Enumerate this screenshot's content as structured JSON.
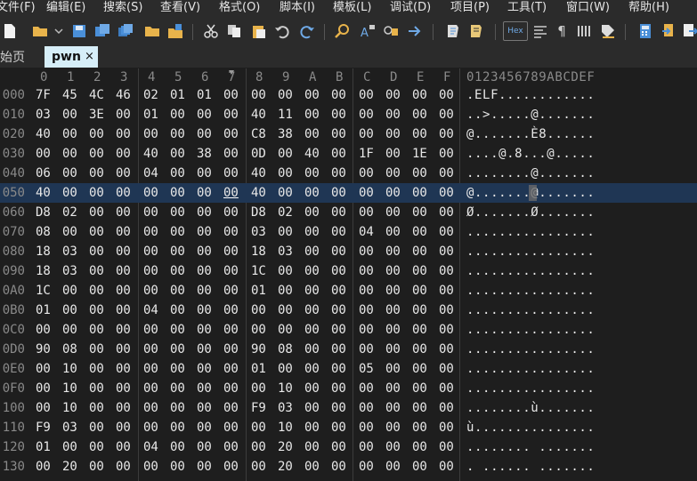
{
  "menus": [
    "文件(F)",
    "编辑(E)",
    "搜索(S)",
    "查看(V)",
    "格式(O)",
    "脚本(I)",
    "模板(L)",
    "调试(D)",
    "项目(P)",
    "工具(T)",
    "窗口(W)",
    "帮助(H)"
  ],
  "tabs": [
    {
      "label": "始页"
    },
    {
      "label": "pwn",
      "close": "×"
    }
  ],
  "toolbar": {
    "hex_label": "Hex"
  },
  "hex_header": [
    "0",
    "1",
    "2",
    "3",
    "4",
    "5",
    "6",
    "7",
    "8",
    "9",
    "A",
    "B",
    "C",
    "D",
    "E",
    "F"
  ],
  "ascii_header": "0123456789ABCDEF",
  "rows": [
    {
      "offset": "000",
      "bytes": [
        "7F",
        "45",
        "4C",
        "46",
        "02",
        "01",
        "01",
        "00",
        "00",
        "00",
        "00",
        "00",
        "00",
        "00",
        "00",
        "00"
      ],
      "ascii": ".ELF............"
    },
    {
      "offset": "010",
      "bytes": [
        "03",
        "00",
        "3E",
        "00",
        "01",
        "00",
        "00",
        "00",
        "40",
        "11",
        "00",
        "00",
        "00",
        "00",
        "00",
        "00"
      ],
      "ascii": "..>.....@......."
    },
    {
      "offset": "020",
      "bytes": [
        "40",
        "00",
        "00",
        "00",
        "00",
        "00",
        "00",
        "00",
        "C8",
        "38",
        "00",
        "00",
        "00",
        "00",
        "00",
        "00"
      ],
      "ascii": "@.......È8......"
    },
    {
      "offset": "030",
      "bytes": [
        "00",
        "00",
        "00",
        "00",
        "40",
        "00",
        "38",
        "00",
        "0D",
        "00",
        "40",
        "00",
        "1F",
        "00",
        "1E",
        "00"
      ],
      "ascii": "....@.8...@....."
    },
    {
      "offset": "040",
      "bytes": [
        "06",
        "00",
        "00",
        "00",
        "04",
        "00",
        "00",
        "00",
        "40",
        "00",
        "00",
        "00",
        "00",
        "00",
        "00",
        "00"
      ],
      "ascii": "........@......."
    },
    {
      "offset": "050",
      "bytes": [
        "40",
        "00",
        "00",
        "00",
        "00",
        "00",
        "00",
        "00",
        "40",
        "00",
        "00",
        "00",
        "00",
        "00",
        "00",
        "00"
      ],
      "ascii": "@.......@.......",
      "highlight": true
    },
    {
      "offset": "060",
      "bytes": [
        "D8",
        "02",
        "00",
        "00",
        "00",
        "00",
        "00",
        "00",
        "D8",
        "02",
        "00",
        "00",
        "00",
        "00",
        "00",
        "00"
      ],
      "ascii": "Ø.......Ø......."
    },
    {
      "offset": "070",
      "bytes": [
        "08",
        "00",
        "00",
        "00",
        "00",
        "00",
        "00",
        "00",
        "03",
        "00",
        "00",
        "00",
        "04",
        "00",
        "00",
        "00"
      ],
      "ascii": "................"
    },
    {
      "offset": "080",
      "bytes": [
        "18",
        "03",
        "00",
        "00",
        "00",
        "00",
        "00",
        "00",
        "18",
        "03",
        "00",
        "00",
        "00",
        "00",
        "00",
        "00"
      ],
      "ascii": "................"
    },
    {
      "offset": "090",
      "bytes": [
        "18",
        "03",
        "00",
        "00",
        "00",
        "00",
        "00",
        "00",
        "1C",
        "00",
        "00",
        "00",
        "00",
        "00",
        "00",
        "00"
      ],
      "ascii": "................"
    },
    {
      "offset": "0A0",
      "bytes": [
        "1C",
        "00",
        "00",
        "00",
        "00",
        "00",
        "00",
        "00",
        "01",
        "00",
        "00",
        "00",
        "00",
        "00",
        "00",
        "00"
      ],
      "ascii": "................"
    },
    {
      "offset": "0B0",
      "bytes": [
        "01",
        "00",
        "00",
        "00",
        "04",
        "00",
        "00",
        "00",
        "00",
        "00",
        "00",
        "00",
        "00",
        "00",
        "00",
        "00"
      ],
      "ascii": "................"
    },
    {
      "offset": "0C0",
      "bytes": [
        "00",
        "00",
        "00",
        "00",
        "00",
        "00",
        "00",
        "00",
        "00",
        "00",
        "00",
        "00",
        "00",
        "00",
        "00",
        "00"
      ],
      "ascii": "................"
    },
    {
      "offset": "0D0",
      "bytes": [
        "90",
        "08",
        "00",
        "00",
        "00",
        "00",
        "00",
        "00",
        "90",
        "08",
        "00",
        "00",
        "00",
        "00",
        "00",
        "00"
      ],
      "ascii": "................"
    },
    {
      "offset": "0E0",
      "bytes": [
        "00",
        "10",
        "00",
        "00",
        "00",
        "00",
        "00",
        "00",
        "01",
        "00",
        "00",
        "00",
        "05",
        "00",
        "00",
        "00"
      ],
      "ascii": "................"
    },
    {
      "offset": "0F0",
      "bytes": [
        "00",
        "10",
        "00",
        "00",
        "00",
        "00",
        "00",
        "00",
        "00",
        "10",
        "00",
        "00",
        "00",
        "00",
        "00",
        "00"
      ],
      "ascii": "................"
    },
    {
      "offset": "100",
      "bytes": [
        "00",
        "10",
        "00",
        "00",
        "00",
        "00",
        "00",
        "00",
        "F9",
        "03",
        "00",
        "00",
        "00",
        "00",
        "00",
        "00"
      ],
      "ascii": "........ù......."
    },
    {
      "offset": "110",
      "bytes": [
        "F9",
        "03",
        "00",
        "00",
        "00",
        "00",
        "00",
        "00",
        "00",
        "10",
        "00",
        "00",
        "00",
        "00",
        "00",
        "00"
      ],
      "ascii": "ù..............."
    },
    {
      "offset": "120",
      "bytes": [
        "01",
        "00",
        "00",
        "00",
        "04",
        "00",
        "00",
        "00",
        "00",
        "20",
        "00",
        "00",
        "00",
        "00",
        "00",
        "00"
      ],
      "ascii": "........ ......."
    },
    {
      "offset": "130",
      "bytes": [
        "00",
        "20",
        "00",
        "00",
        "00",
        "00",
        "00",
        "00",
        "00",
        "20",
        "00",
        "00",
        "00",
        "00",
        "00",
        "00"
      ],
      "ascii": ". ...... ......."
    }
  ],
  "colors": {
    "background": "#1e1e1e",
    "highlight": "#1f3654",
    "tab_active": "#d6eef8"
  }
}
